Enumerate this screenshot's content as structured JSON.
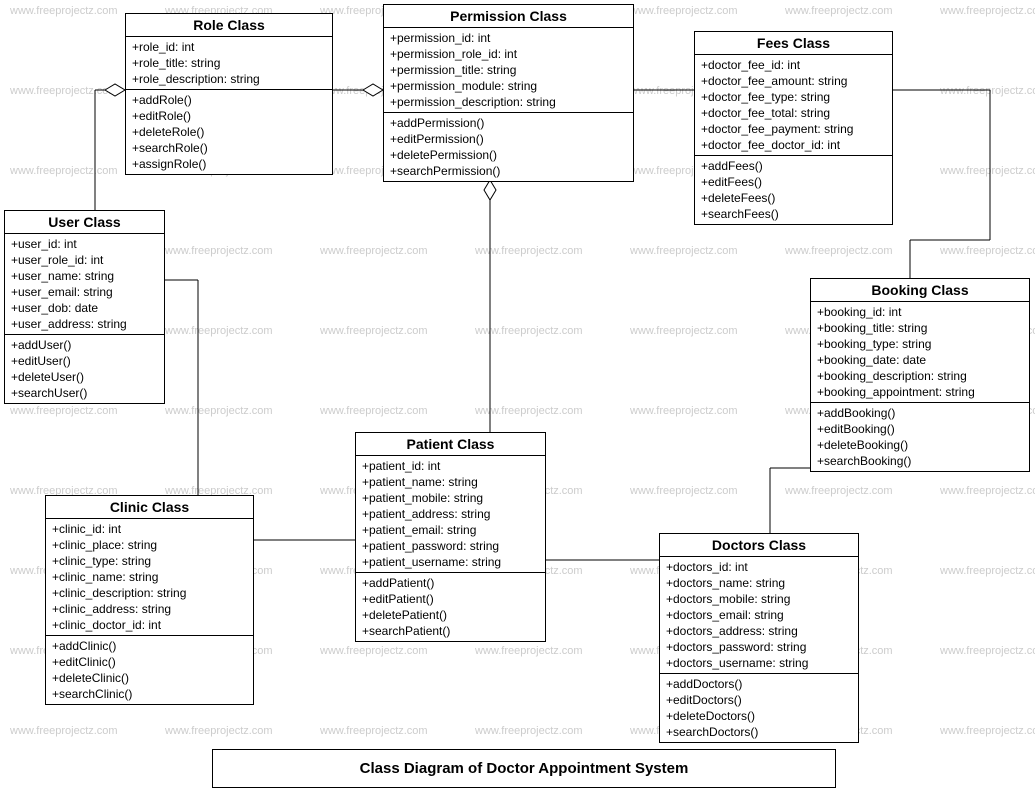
{
  "diagram_title": "Class Diagram of Doctor Appointment System",
  "watermark_text": "www.freeprojectz.com",
  "classes": {
    "role": {
      "name": "Role Class",
      "attrs": [
        "+role_id: int",
        "+role_title: string",
        "+role_description: string"
      ],
      "methods": [
        "+addRole()",
        "+editRole()",
        "+deleteRole()",
        "+searchRole()",
        "+assignRole()"
      ]
    },
    "permission": {
      "name": "Permission Class",
      "attrs": [
        "+permission_id: int",
        "+permission_role_id: int",
        "+permission_title: string",
        "+permission_module: string",
        "+permission_description: string"
      ],
      "methods": [
        "+addPermission()",
        "+editPermission()",
        "+deletePermission()",
        "+searchPermission()"
      ]
    },
    "fees": {
      "name": "Fees Class",
      "attrs": [
        "+doctor_fee_id: int",
        "+doctor_fee_amount: string",
        "+doctor_fee_type: string",
        "+doctor_fee_total: string",
        "+doctor_fee_payment: string",
        "+doctor_fee_doctor_id: int"
      ],
      "methods": [
        "+addFees()",
        "+editFees()",
        "+deleteFees()",
        "+searchFees()"
      ]
    },
    "user": {
      "name": "User Class",
      "attrs": [
        "+user_id: int",
        "+user_role_id: int",
        "+user_name: string",
        "+user_email: string",
        "+user_dob: date",
        "+user_address: string"
      ],
      "methods": [
        "+addUser()",
        "+editUser()",
        "+deleteUser()",
        "+searchUser()"
      ]
    },
    "booking": {
      "name": "Booking Class",
      "attrs": [
        "+booking_id: int",
        "+booking_title: string",
        "+booking_type: string",
        "+booking_date: date",
        "+booking_description: string",
        "+booking_appointment: string"
      ],
      "methods": [
        "+addBooking()",
        "+editBooking()",
        "+deleteBooking()",
        "+searchBooking()"
      ]
    },
    "patient": {
      "name": "Patient Class",
      "attrs": [
        "+patient_id: int",
        "+patient_name: string",
        "+patient_mobile: string",
        "+patient_address: string",
        "+patient_email: string",
        "+patient_password: string",
        "+patient_username: string"
      ],
      "methods": [
        "+addPatient()",
        "+editPatient()",
        "+deletePatient()",
        "+searchPatient()"
      ]
    },
    "clinic": {
      "name": "Clinic Class",
      "attrs": [
        "+clinic_id: int",
        "+clinic_place: string",
        "+clinic_type: string",
        "+clinic_name: string",
        "+clinic_description: string",
        "+clinic_address: string",
        "+clinic_doctor_id: int"
      ],
      "methods": [
        "+addClinic()",
        "+editClinic()",
        "+deleteClinic()",
        "+searchClinic()"
      ]
    },
    "doctors": {
      "name": "Doctors Class",
      "attrs": [
        "+doctors_id: int",
        "+doctors_name: string",
        "+doctors_mobile: string",
        "+doctors_email: string",
        "+doctors_address: string",
        "+doctors_password: string",
        "+doctors_username: string"
      ],
      "methods": [
        "+addDoctors()",
        "+editDoctors()",
        "+deleteDoctors()",
        "+searchDoctors()"
      ]
    }
  }
}
